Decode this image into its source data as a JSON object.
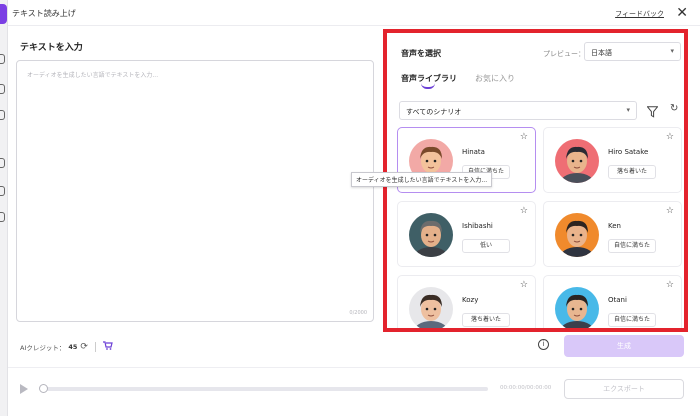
{
  "window": {
    "title": "テキスト読み上げ",
    "feedback_label": "フィードバック",
    "close_glyph": "✕"
  },
  "left": {
    "heading": "テキストを入力",
    "placeholder": "オーディオを生成したい言語でテキストを入力...",
    "char_count": "0/2000",
    "credit_label": "AIクレジット：",
    "credit_value": "45"
  },
  "voice_panel": {
    "title": "音声を選択",
    "preview_label": "プレビュー：",
    "language": "日本語",
    "tabs": [
      {
        "label": "音声ライブラリ",
        "active": true
      },
      {
        "label": "お気に入り",
        "active": false
      }
    ],
    "scenario": "すべてのシナリオ",
    "voices": [
      {
        "name": "Hinata",
        "tag": "自信に満ちた",
        "selected": true,
        "bg": "#f2a9a6",
        "skin": "#f3c29b",
        "hair": "#7a4a2a",
        "shirt": "#8fa1b8"
      },
      {
        "name": "Hiro Satake",
        "tag": "落ち着いた",
        "selected": false,
        "bg": "#ef6e74",
        "skin": "#e9b48c",
        "hair": "#2b2b33",
        "shirt": "#4a4f5a"
      },
      {
        "name": "Ishibashi",
        "tag": "低い",
        "selected": false,
        "bg": "#3f5f66",
        "skin": "#e4b08a",
        "hair": "#6c6c6c",
        "shirt": "#3b3f45"
      },
      {
        "name": "Ken",
        "tag": "自信に満ちた",
        "selected": false,
        "bg": "#f08a2c",
        "skin": "#eab38b",
        "hair": "#2d2420",
        "shirt": "#2f3440"
      },
      {
        "name": "Kozy",
        "tag": "落ち着いた",
        "selected": false,
        "bg": "#e7e7ea",
        "skin": "#eec0a0",
        "hair": "#3a2d25",
        "shirt": "#5b6a7d"
      },
      {
        "name": "Otani",
        "tag": "自信に満ちた",
        "selected": false,
        "bg": "#48b9e8",
        "skin": "#e8b690",
        "hair": "#2a2422",
        "shirt": "#3a404c"
      }
    ]
  },
  "tooltip": "オーディオを生成したい言語でテキストを入力...",
  "buttons": {
    "generate": "生成",
    "export": "エクスポート"
  },
  "player": {
    "time": "00:00:00/00:00:00",
    "progress": 0
  }
}
